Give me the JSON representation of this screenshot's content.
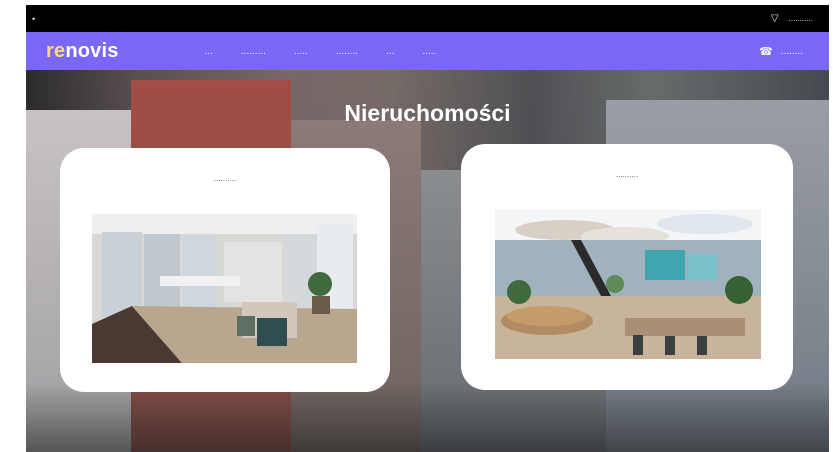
{
  "topbar": {
    "left_icon": "•",
    "right_icon": "▽",
    "right_text": "..........."
  },
  "nav": {
    "logo": {
      "prefix": "re",
      "suffix": "novis"
    },
    "menu": [
      {
        "label": "..."
      },
      {
        "label": "........."
      },
      {
        "label": "....."
      },
      {
        "label": "........"
      },
      {
        "label": "..."
      },
      {
        "label": "....."
      }
    ],
    "phone": {
      "icon": "☎",
      "text": "........"
    }
  },
  "hero": {
    "title": "Nieruchomości",
    "cards": [
      {
        "label": "..........",
        "photo": "office-interior"
      },
      {
        "label": "..........",
        "photo": "coworking-interior"
      }
    ]
  },
  "colors": {
    "nav_bg": "#7a67f6",
    "logo_accent": "#fdd77a",
    "topbar_bg": "#000000"
  }
}
